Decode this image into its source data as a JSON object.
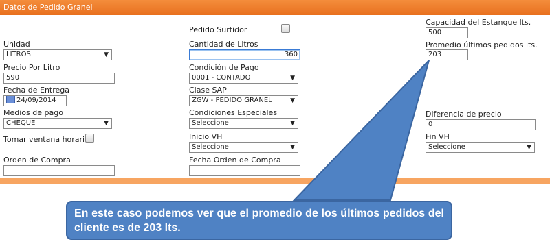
{
  "header": {
    "title": "Datos de Pedido Granel"
  },
  "col1": {
    "unidad": {
      "label": "Unidad",
      "value": "LITROS"
    },
    "precio": {
      "label": "Precio Por Litro",
      "value": "590"
    },
    "fecha_entrega": {
      "label": "Fecha de Entrega",
      "value": "24/09/2014"
    },
    "medios_pago": {
      "label": "Medios de pago",
      "value": "CHEQUE"
    },
    "ventana": {
      "label": "Tomar ventana horaria"
    },
    "orden_compra": {
      "label": "Orden de Compra",
      "value": ""
    }
  },
  "col2": {
    "surtidor": {
      "label": "Pedido Surtidor"
    },
    "cantidad": {
      "label": "Cantidad de Litros",
      "value": "360"
    },
    "condicion": {
      "label": "Condición de Pago",
      "value": "0001 - CONTADO"
    },
    "clase": {
      "label": "Clase SAP",
      "value": "ZGW - PEDIDO GRANEL"
    },
    "condiciones_esp": {
      "label": "Condiciones Especiales",
      "value": "Seleccione"
    },
    "inicio_vh": {
      "label": "Inicio VH",
      "value": "Seleccione"
    },
    "fecha_orden": {
      "label": "Fecha Orden de Compra",
      "value": ""
    }
  },
  "col3": {
    "capacidad": {
      "label": "Capacidad del Estanque lts.",
      "value": "500"
    },
    "promedio": {
      "label": "Promedio últimos pedidos lts.",
      "value": "203"
    },
    "diferencia": {
      "label": "Diferencia de precio",
      "value": "0"
    },
    "fin_vh": {
      "label": "Fin VH",
      "value": "Seleccione"
    }
  },
  "callout": {
    "text": "En este caso podemos ver que el promedio de los últimos pedidos del cliente es de 203 lts."
  },
  "colors": {
    "header": "#e8701e",
    "callout": "#4f82c4",
    "border_accent": "#f7a561"
  }
}
